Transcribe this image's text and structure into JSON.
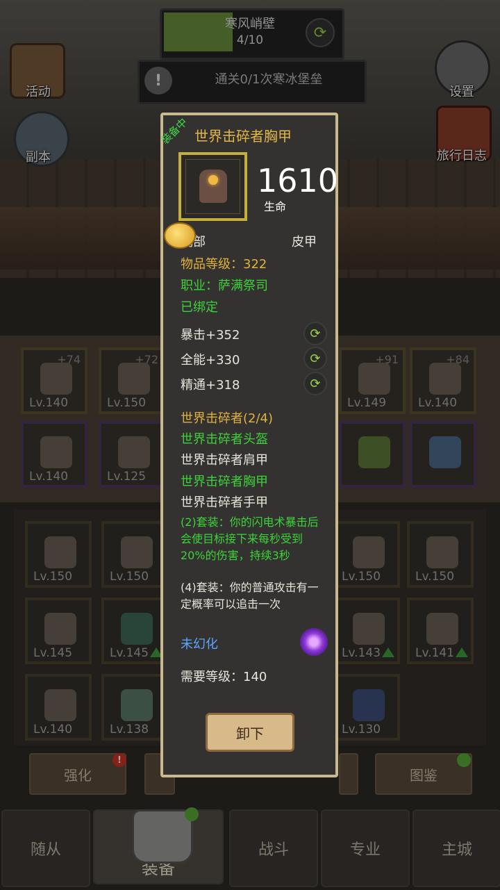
{
  "quest": {
    "title": "寒风峭壁",
    "progress_text": "4/10",
    "progress_value": 0.4
  },
  "task": {
    "icon": "!",
    "text": "通关0/1次寒冰堡垒"
  },
  "left_menu": [
    {
      "label": "活动",
      "icon": "scroll-icon"
    },
    {
      "label": "副本",
      "icon": "portal-icon"
    }
  ],
  "right_menu": [
    {
      "label": "设置",
      "icon": "gear-icon"
    },
    {
      "label": "旅行日志",
      "icon": "book-icon"
    }
  ],
  "grid_top": {
    "row1": [
      {
        "plus": "+74",
        "lv": "Lv.140"
      },
      {
        "plus": "+72",
        "lv": "Lv.150"
      },
      {
        "plus": "+91",
        "lv": "Lv.149"
      },
      {
        "plus": "+84",
        "lv": "Lv.140"
      }
    ],
    "row2": [
      {
        "lv": "Lv.140"
      },
      {
        "lv": "Lv.125"
      },
      {
        "lv": ""
      },
      {
        "lv": ""
      }
    ]
  },
  "grid_bottom": {
    "row1": [
      {
        "lv": "Lv.150"
      },
      {
        "lv": "Lv.150"
      },
      {
        "lv": "Lv.150"
      },
      {
        "lv": "Lv.150"
      }
    ],
    "row2": [
      {
        "lv": "Lv.145"
      },
      {
        "lv": "Lv.145"
      },
      {
        "lv": "Lv.143"
      },
      {
        "lv": "Lv.141"
      }
    ],
    "row3": [
      {
        "lv": "Lv.140"
      },
      {
        "lv": "Lv.138"
      },
      {
        "lv": "Lv.130"
      }
    ]
  },
  "actions": {
    "enhance": "强化",
    "enhance_badge": "!",
    "codex": "图鉴"
  },
  "nav": {
    "followers": "随从",
    "equipment": "装备",
    "battle": "战斗",
    "profession": "专业",
    "main_city": "主城"
  },
  "tooltip": {
    "equipped_tag": "装备中",
    "name": "世界击碎者胸甲",
    "main_stat_value": "1610",
    "main_stat_label": "生命",
    "slot": "胸部",
    "armor_type": "皮甲",
    "item_level": "物品等级：322",
    "class_req": "职业：萨满祭司",
    "bound": "已绑定",
    "stats": [
      "暴击+352",
      "全能+330",
      "精通+318"
    ],
    "set_name": "世界击碎者(2/4)",
    "set_pieces": [
      {
        "name": "世界击碎者头盔",
        "owned": true
      },
      {
        "name": "世界击碎者肩甲",
        "owned": false
      },
      {
        "name": "世界击碎者胸甲",
        "owned": true
      },
      {
        "name": "世界击碎者手甲",
        "owned": false
      }
    ],
    "set_bonus_2": "(2)套装：你的闪电术暴击后会使目标接下来每秒受到20%的伤害，持续3秒",
    "set_bonus_4": "(4)套装：你的普通攻击有一定概率可以追击一次",
    "transmog": "未幻化",
    "required_level": "需要等级：140",
    "unequip_label": "卸下"
  }
}
